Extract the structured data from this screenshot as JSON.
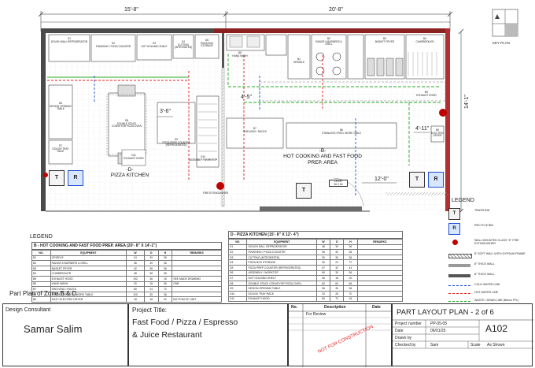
{
  "dimensions": {
    "top_left": "15'-8\"",
    "top_right": "20'-8\"",
    "right_height": "14'-1\"",
    "mid_1": "4'-5\"",
    "mid_2": "3'-6\"",
    "mid_3": "4'-11\"",
    "mid_4": "12'-0\""
  },
  "key_plan": {
    "label": "KEY PLAN"
  },
  "zones": {
    "d": {
      "tag": "-D-",
      "name": "PIZZA KITCHEN"
    },
    "b": {
      "tag": "-B-",
      "name": "HOT COOKING AND FAST FOOD PREP. AREA"
    }
  },
  "plan_items": {
    "d1": {
      "code": "D1",
      "name": "DOUGH BALL REFRIGERATOR"
    },
    "d2": {
      "code": "D2",
      "name": "FINISHING / PIZZA COUNTER"
    },
    "d3": {
      "code": "D3",
      "name": "HOT HOLDING SHELF"
    },
    "d4": {
      "code": "D4",
      "name": "CUTTING (INTEGRATED)"
    },
    "d5": {
      "code": "D5",
      "name": "PIZZA BOX STORAGE"
    },
    "d6": {
      "code": "D6",
      "name": "DESIGN OPENING TABLE"
    },
    "d7": {
      "code": "D7",
      "name": "DOUGH TRAY RACK"
    },
    "d8": {
      "code": "D8",
      "name": "DOUBLE STACK CONVEYOR PIZZA OVEN"
    },
    "d9": {
      "code": "D9",
      "name": "PIZZA PREP COUNTER (REFRIGERATED)"
    },
    "d10": {
      "code": "D10",
      "name": "ASSEMBLY / WORKTOP"
    },
    "d11": {
      "code": "D11",
      "name": "EXHAUST HOOD"
    },
    "b1": {
      "code": "B1",
      "name": "GRIDDLE"
    },
    "b2": {
      "code": "B2",
      "name": "RANGE 6 BURNERS & GRILL"
    },
    "b3": {
      "code": "B3",
      "name": "BASKET FRYER"
    },
    "b4": {
      "code": "B4",
      "name": "CHARBROILER"
    },
    "b5": {
      "code": "B5",
      "name": "EXHAUST HOOD"
    },
    "b6": {
      "code": "B6",
      "name": "STAINLESS STEEL WORK TABLE"
    },
    "b7": {
      "code": "B7",
      "name": "SHELVING / RACKS"
    },
    "b8": {
      "code": "B8",
      "name": "HAND WASH"
    },
    "b9": {
      "code": "B9",
      "name": "ELECTRIC DRYER"
    },
    "door": {
      "code": "DOOR",
      "size": "36 X 84"
    },
    "fire_ext": "FIRE EXTINGUISHER",
    "trash": "T",
    "recycle": "R"
  },
  "table_b": {
    "title": "B - HOT COOKING AND FAST FOOD PREP. AREA (20'- 8\" X 14'-1\")",
    "headers": [
      "NO.",
      "EQUIPMENT",
      "W",
      "D",
      "H",
      "REMARKS"
    ],
    "rows": [
      [
        "B1",
        "GRIDDLE",
        "24",
        "30",
        "36",
        ""
      ],
      [
        "B2",
        "RANGE 6 BURNERS & GRILL",
        "36",
        "30",
        "36",
        ""
      ],
      [
        "B3",
        "BASKET FRYER",
        "42",
        "36",
        "36",
        ""
      ],
      [
        "B4",
        "CHARBROILER",
        "48",
        "36",
        "36",
        ""
      ],
      [
        "B5",
        "EXHAUST HOOD",
        "192",
        "36",
        "18",
        "SEE MADE DRAWING"
      ],
      [
        "B6",
        "HAND WASH",
        "20",
        "18",
        "36",
        "ONE"
      ],
      [
        "B7",
        "SHELVING / RACKS",
        "60",
        "24",
        "72",
        ""
      ],
      [
        "B8",
        "STAINLESS STEEL WORK TABLE",
        "120",
        "30",
        "36",
        ""
      ],
      [
        "B9",
        "GAS / ELECTRIC DRYER",
        "18",
        "18",
        "22",
        "BOTTOM OF UNIT"
      ]
    ]
  },
  "table_d": {
    "title": "D - PIZZA KITCHEN (15'- 8\" X 12'- 4\")",
    "headers": [
      "NO.",
      "EQUIPMENT",
      "W",
      "D",
      "H",
      "REMARKS"
    ],
    "rows": [
      [
        "D1",
        "DOUGH BALL REFRIGERATOR",
        "48",
        "30",
        "36",
        ""
      ],
      [
        "D2",
        "FINISHING / PIZZA COUNTER",
        "96",
        "30",
        "36",
        ""
      ],
      [
        "D3",
        "CUTTING (INTEGRATED)",
        "30",
        "30",
        "36",
        ""
      ],
      [
        "D4",
        "PIZZA BOX STORAGE",
        "30",
        "24",
        "72",
        ""
      ],
      [
        "D5",
        "PIZZA PREP COUNTER (REFRIGERATED)",
        "67",
        "32",
        "44",
        ""
      ],
      [
        "D6",
        "ASSEMBLY / WORKTOP",
        "60",
        "30",
        "36",
        ""
      ],
      [
        "D7",
        "HOT HOLDING SHELF",
        "36",
        "16",
        "20",
        ""
      ],
      [
        "D8",
        "DOUBLE STACK CONVEYOR PIZZA OVEN",
        "60",
        "60",
        "66",
        ""
      ],
      [
        "D9",
        "DESIGN OPENING TABLE",
        "36",
        "30",
        "36",
        ""
      ],
      [
        "D10",
        "DOUGH TRAY RACK",
        "20",
        "26",
        "70",
        ""
      ],
      [
        "D11",
        "EXHAUST HOOD",
        "60",
        "72",
        "18",
        ""
      ]
    ]
  },
  "legend": {
    "title": "LEGEND",
    "items": [
      {
        "symbol": "T",
        "text": "TRASH BIN"
      },
      {
        "symbol": "R",
        "text": "RECYCLE BIN"
      },
      {
        "symbol": "",
        "text": "WALL MOUNTED CLASS \"K\" FIRE EXTINGUISHER"
      },
      {
        "symbol": "",
        "text": "8\" SOFT WALL WITH GYPSUM FRAME"
      },
      {
        "symbol": "",
        "text": "8\" THICK WALL"
      },
      {
        "symbol": "",
        "text": "8\" THICK WALL"
      },
      {
        "symbol": "",
        "text": "COLD WATER LINE"
      },
      {
        "symbol": "",
        "text": "HOT WATER LINE"
      },
      {
        "symbol": "",
        "text": "WASTE / DRAIN LINE (Below FFL)"
      }
    ],
    "colors": {
      "cold": "#1f4fd8",
      "hot": "#e02020",
      "drain": "#22aa22",
      "wall_dark": "#555555",
      "wall_mid": "#999999"
    }
  },
  "section_headers": {
    "legend_left": "LEGEND"
  },
  "caption": "Part Plan of Zone B & D",
  "title_block": {
    "consultant_label": "Design Consultant",
    "consultant_name": "Samar Salim",
    "project_label": "Project Title:",
    "project_line1": "Fast Food / Pizza / Espresso",
    "project_line2": "& Juice Restaurant",
    "rev_headers": [
      "No.",
      "Description",
      "Date"
    ],
    "rev_row": "For Review",
    "stamp": "NOT FOR CONSTRUCTION",
    "sheet_title": "PART LAYOUT PLAN - 2 of 6",
    "project_number_label": "Project number",
    "project_number": "PP-05-05",
    "date_label": "Date",
    "date": "06/01/25",
    "drawn_label": "Drawn by",
    "drawn": "",
    "checked_label": "Checked by",
    "checked": "Sam",
    "sheet_number": "A102",
    "scale_label": "Scale",
    "scale": "As Shown"
  },
  "colors": {
    "wall": "#4a4a4a",
    "pipe_red": "#e02020",
    "pipe_blue": "#1f4fd8",
    "pipe_green": "#22aa22",
    "fire": "#c00000"
  }
}
